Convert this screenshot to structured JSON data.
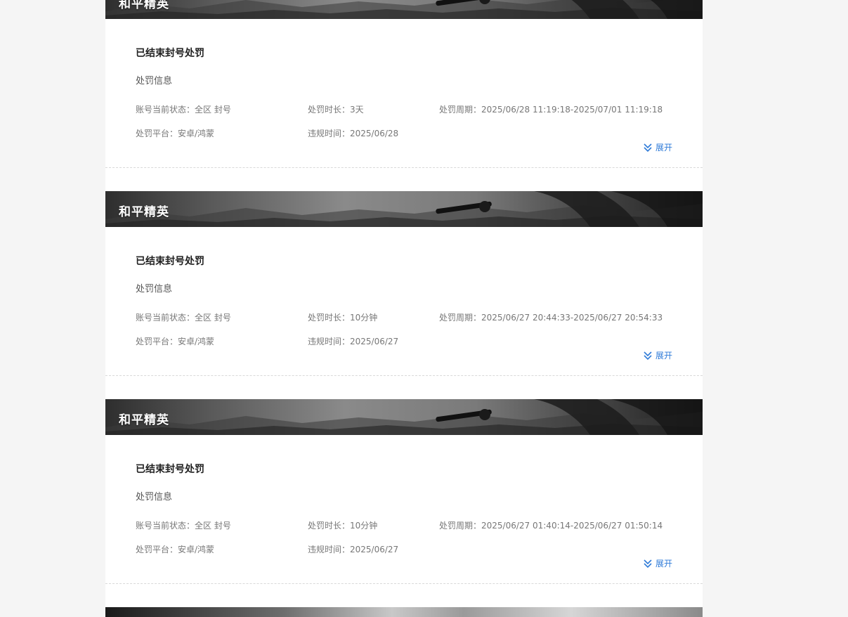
{
  "records": [
    {
      "game_name": "和平精英",
      "status_title": "已结束封号处罚",
      "section_label": "处罚信息",
      "account_status_label": "账号当前状态：",
      "account_status_value": "全区 封号",
      "duration_label": "处罚时长：",
      "duration_value": "3天",
      "period_label": "处罚周期：",
      "period_value": "2025/06/28 11:19:18-2025/07/01 11:19:18",
      "platform_label": "处罚平台：",
      "platform_value": "安卓/鸿蒙",
      "violation_time_label": "违规时间：",
      "violation_time_value": "2025/06/28",
      "expand_label": "展开"
    },
    {
      "game_name": "和平精英",
      "status_title": "已结束封号处罚",
      "section_label": "处罚信息",
      "account_status_label": "账号当前状态：",
      "account_status_value": "全区 封号",
      "duration_label": "处罚时长：",
      "duration_value": "10分钟",
      "period_label": "处罚周期：",
      "period_value": "2025/06/27 20:44:33-2025/06/27 20:54:33",
      "platform_label": "处罚平台：",
      "platform_value": "安卓/鸿蒙",
      "violation_time_label": "违规时间：",
      "violation_time_value": "2025/06/27",
      "expand_label": "展开"
    },
    {
      "game_name": "和平精英",
      "status_title": "已结束封号处罚",
      "section_label": "处罚信息",
      "account_status_label": "账号当前状态：",
      "account_status_value": "全区 封号",
      "duration_label": "处罚时长：",
      "duration_value": "10分钟",
      "period_label": "处罚周期：",
      "period_value": "2025/06/27 01:40:14-2025/06/27 01:50:14",
      "platform_label": "处罚平台：",
      "platform_value": "安卓/鸿蒙",
      "violation_time_label": "违规时间：",
      "violation_time_value": "2025/06/27",
      "expand_label": "展开"
    }
  ],
  "colors": {
    "accent": "#2f7bd8",
    "page_bg": "#f5f5f5",
    "card_bg": "#ffffff"
  },
  "icons": {
    "expand": "double-chevron-down-icon"
  }
}
